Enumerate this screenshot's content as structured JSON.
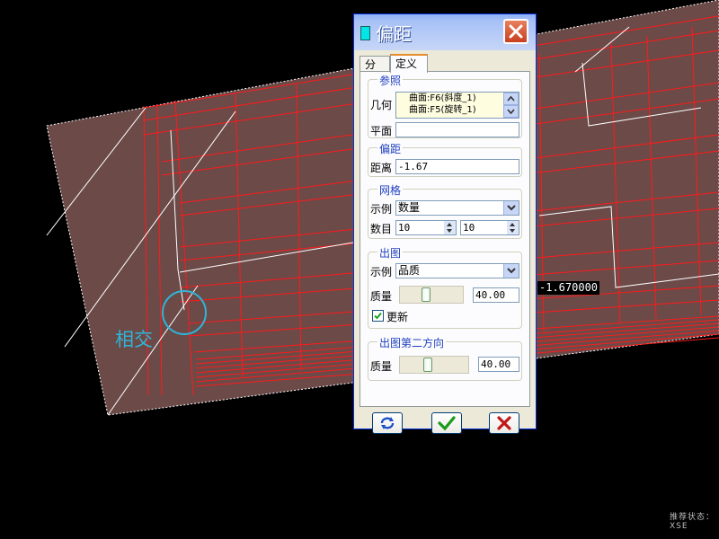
{
  "viewport": {
    "annotation_label": "相交",
    "value_tag": "-1.670000",
    "status_text": "推荐状态：XSE"
  },
  "dialog": {
    "title": "偏距",
    "tabs": [
      {
        "label": "分析",
        "active": false
      },
      {
        "label": "定义",
        "active": true
      }
    ],
    "reference": {
      "group_label": "参照",
      "geometry_label": "几何",
      "geometry_items": [
        "曲面:F6(斜度_1)",
        "曲面:F5(旋转_1)"
      ],
      "plane_label": "平面",
      "plane_value": ""
    },
    "offset": {
      "group_label": "偏距",
      "distance_label": "距离",
      "distance_value": "-1.67"
    },
    "mesh": {
      "group_label": "网格",
      "sample_label": "示例",
      "sample_value": "数量",
      "count_label": "数目",
      "count_1": "10",
      "count_2": "10"
    },
    "plot": {
      "group_label": "出图",
      "sample_label": "示例",
      "sample_value": "品质",
      "quality_label": "质量",
      "quality_value": "40.00",
      "quality_level": 0.4,
      "update_label": "更新",
      "update_checked": true
    },
    "plot_second": {
      "group_label": "出图第二方向",
      "quality_label": "质量",
      "quality_value": "40.00",
      "quality_level": 0.4
    },
    "buttons": {
      "refresh": "refresh-icon",
      "ok": "check-icon",
      "cancel": "x-icon"
    }
  }
}
